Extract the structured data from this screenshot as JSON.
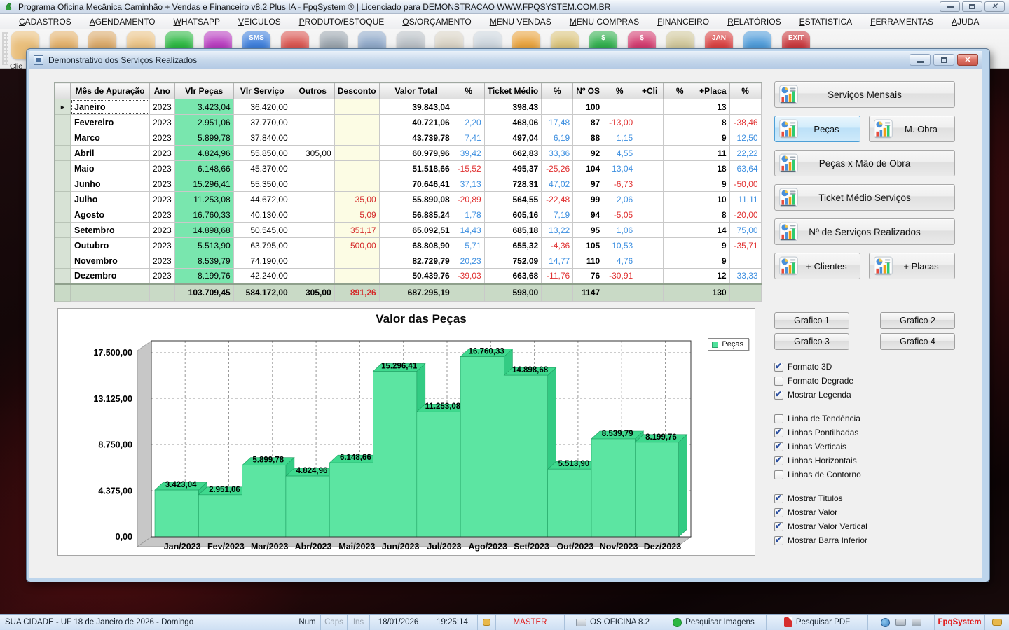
{
  "window": {
    "title": "Programa Oficina Mecânica Caminhão + Vendas e Financeiro v8.2 Plus IA - FpqSystem ® | Licenciado para  DEMONSTRACAO WWW.FPQSYSTEM.COM.BR"
  },
  "menu": {
    "items": [
      "CADASTROS",
      "AGENDAMENTO",
      "WHATSAPP",
      "VEICULOS",
      "PRODUTO/ESTOQUE",
      "OS/ORÇAMENTO",
      "MENU VENDAS",
      "MENU COMPRAS",
      "FINANCEIRO",
      "RELATÓRIOS",
      "ESTATISTICA",
      "FERRAMENTAS",
      "AJUDA"
    ],
    "separator": "|"
  },
  "toolbar": {
    "partial_label": "Clie",
    "items": [
      {
        "name": "clientes",
        "color": "#E9BE7A",
        "glyph": ""
      },
      {
        "name": "fornecedores",
        "color": "#E2B06A",
        "glyph": ""
      },
      {
        "name": "funcionarios",
        "color": "#D9A868",
        "glyph": ""
      },
      {
        "name": "usuarios",
        "color": "#E9C285",
        "glyph": ""
      },
      {
        "name": "whatsapp",
        "color": "#2BB741",
        "glyph": ""
      },
      {
        "name": "instagram",
        "color": "#B73BBF",
        "glyph": ""
      },
      {
        "name": "sms",
        "color": "#3D7EDB",
        "glyph": "SMS"
      },
      {
        "name": "graficos",
        "color": "#D8544F",
        "glyph": ""
      },
      {
        "name": "codigo-barras",
        "color": "#9AA4AD",
        "glyph": ""
      },
      {
        "name": "veiculos",
        "color": "#8FA8C8",
        "glyph": ""
      },
      {
        "name": "impressos",
        "color": "#B8BEC4",
        "glyph": ""
      },
      {
        "name": "ordem-servico",
        "color": "#D8D2C4",
        "glyph": ""
      },
      {
        "name": "documentos",
        "color": "#CBD4DC",
        "glyph": ""
      },
      {
        "name": "arquivos",
        "color": "#E8A23C",
        "glyph": ""
      },
      {
        "name": "caixa",
        "color": "#D9C27A",
        "glyph": ""
      },
      {
        "name": "receitas",
        "color": "#2FAE4C",
        "glyph": "$"
      },
      {
        "name": "despesas",
        "color": "#D23A6E",
        "glyph": "$"
      },
      {
        "name": "notas",
        "color": "#CFC69A",
        "glyph": ""
      },
      {
        "name": "calendario",
        "color": "#D84040",
        "glyph": "JAN"
      },
      {
        "name": "internet",
        "color": "#4D9AD8",
        "glyph": ""
      },
      {
        "name": "sair",
        "color": "#C8373C",
        "glyph": "EXIT"
      }
    ]
  },
  "window2": {
    "title": "Demonstrativo dos Serviços Realizados"
  },
  "table": {
    "columns": [
      "Mês de Apuração",
      "Ano",
      "Vlr Peças",
      "Vlr Serviço",
      "Outros",
      "Desconto",
      "Valor Total",
      "%",
      "Ticket Médio",
      "%",
      "Nº OS",
      "%",
      "+Cli",
      "%",
      "+Placa",
      "%"
    ],
    "rows": [
      [
        "Janeiro",
        "2023",
        "3.423,04",
        "36.420,00",
        "",
        "",
        "39.843,04",
        "",
        "398,43",
        "",
        "100",
        "",
        "",
        "",
        "13",
        ""
      ],
      [
        "Fevereiro",
        "2023",
        "2.951,06",
        "37.770,00",
        "",
        "",
        "40.721,06",
        "2,20",
        "468,06",
        "17,48",
        "87",
        "-13,00",
        "",
        "",
        "8",
        "-38,46"
      ],
      [
        "Marco",
        "2023",
        "5.899,78",
        "37.840,00",
        "",
        "",
        "43.739,78",
        "7,41",
        "497,04",
        "6,19",
        "88",
        "1,15",
        "",
        "",
        "9",
        "12,50"
      ],
      [
        "Abril",
        "2023",
        "4.824,96",
        "55.850,00",
        "305,00",
        "",
        "60.979,96",
        "39,42",
        "662,83",
        "33,36",
        "92",
        "4,55",
        "",
        "",
        "11",
        "22,22"
      ],
      [
        "Maio",
        "2023",
        "6.148,66",
        "45.370,00",
        "",
        "",
        "51.518,66",
        "-15,52",
        "495,37",
        "-25,26",
        "104",
        "13,04",
        "",
        "",
        "18",
        "63,64"
      ],
      [
        "Junho",
        "2023",
        "15.296,41",
        "55.350,00",
        "",
        "",
        "70.646,41",
        "37,13",
        "728,31",
        "47,02",
        "97",
        "-6,73",
        "",
        "",
        "9",
        "-50,00"
      ],
      [
        "Julho",
        "2023",
        "11.253,08",
        "44.672,00",
        "",
        "35,00",
        "55.890,08",
        "-20,89",
        "564,55",
        "-22,48",
        "99",
        "2,06",
        "",
        "",
        "10",
        "11,11"
      ],
      [
        "Agosto",
        "2023",
        "16.760,33",
        "40.130,00",
        "",
        "5,09",
        "56.885,24",
        "1,78",
        "605,16",
        "7,19",
        "94",
        "-5,05",
        "",
        "",
        "8",
        "-20,00"
      ],
      [
        "Setembro",
        "2023",
        "14.898,68",
        "50.545,00",
        "",
        "351,17",
        "65.092,51",
        "14,43",
        "685,18",
        "13,22",
        "95",
        "1,06",
        "",
        "",
        "14",
        "75,00"
      ],
      [
        "Outubro",
        "2023",
        "5.513,90",
        "63.795,00",
        "",
        "500,00",
        "68.808,90",
        "5,71",
        "655,32",
        "-4,36",
        "105",
        "10,53",
        "",
        "",
        "9",
        "-35,71"
      ],
      [
        "Novembro",
        "2023",
        "8.539,79",
        "74.190,00",
        "",
        "",
        "82.729,79",
        "20,23",
        "752,09",
        "14,77",
        "110",
        "4,76",
        "",
        "",
        "9",
        ""
      ],
      [
        "Dezembro",
        "2023",
        "8.199,76",
        "42.240,00",
        "",
        "",
        "50.439,76",
        "-39,03",
        "663,68",
        "-11,76",
        "76",
        "-30,91",
        "",
        "",
        "12",
        "33,33"
      ]
    ],
    "total": [
      "",
      "",
      "103.709,45",
      "584.172,00",
      "305,00",
      "891,26",
      "687.295,19",
      "",
      "598,00",
      "",
      "1147",
      "",
      "",
      "",
      "130",
      ""
    ]
  },
  "panel": {
    "buttons": [
      {
        "id": "servicos-mensais",
        "label": "Serviços Mensais",
        "active": false
      },
      {
        "id": "pecas",
        "label": "Peças",
        "active": true
      },
      {
        "id": "m-obra",
        "label": "M. Obra",
        "active": false
      },
      {
        "id": "pecas-x-mao-de-obra",
        "label": "Peças x Mão de Obra",
        "active": false
      },
      {
        "id": "ticket-medio-servicos",
        "label": "Ticket Médio Serviços",
        "active": false
      },
      {
        "id": "n-de-servicos-realizados",
        "label": "Nº de Serviços Realizados",
        "active": false
      },
      {
        "id": "clientes",
        "label": "+ Clientes",
        "active": false
      },
      {
        "id": "placas",
        "label": "+ Placas",
        "active": false
      }
    ],
    "grafico_buttons": [
      "Grafico 1",
      "Grafico 2",
      "Grafico 3",
      "Grafico 4"
    ],
    "checkbox_groups": [
      [
        {
          "label": "Formato 3D",
          "checked": true
        },
        {
          "label": "Formato Degrade",
          "checked": false
        },
        {
          "label": "Mostrar Legenda",
          "checked": true
        }
      ],
      [
        {
          "label": "Linha de Tendência",
          "checked": false
        },
        {
          "label": "Linhas Pontilhadas",
          "checked": true
        },
        {
          "label": "Linhas Verticais",
          "checked": true
        },
        {
          "label": "Linhas Horizontais",
          "checked": true
        },
        {
          "label": "Linhas de Contorno",
          "checked": false
        }
      ],
      [
        {
          "label": "Mostrar Titulos",
          "checked": true
        },
        {
          "label": "Mostrar Valor",
          "checked": true
        },
        {
          "label": "Mostrar Valor Vertical",
          "checked": true
        },
        {
          "label": "Mostrar Barra Inferior",
          "checked": true
        }
      ]
    ]
  },
  "chart_data": {
    "type": "bar",
    "title": "Valor das Peças",
    "legend": "Peças",
    "legend_position": "top-right",
    "grid": true,
    "style": "3d",
    "categories": [
      "Jan/2023",
      "Fev/2023",
      "Mar/2023",
      "Abr/2023",
      "Mai/2023",
      "Jun/2023",
      "Jul/2023",
      "Ago/2023",
      "Set/2023",
      "Out/2023",
      "Nov/2023",
      "Dez/2023"
    ],
    "values": [
      3423.04,
      2951.06,
      5899.78,
      4824.96,
      6148.66,
      15296.41,
      11253.08,
      16760.33,
      14898.68,
      5513.9,
      8539.79,
      8199.76
    ],
    "value_labels": [
      "3.423,04",
      "2.951,06",
      "5.899,78",
      "4.824,96",
      "6.148,66",
      "15.296,41",
      "11.253,08",
      "16.760,33",
      "14.898,68",
      "5.513,90",
      "8.539,79",
      "8.199,76"
    ],
    "ylim": [
      0,
      17500
    ],
    "yticks": [
      "0,00",
      "4.375,00",
      "8.750,00",
      "13.125,00",
      "17.500,00"
    ],
    "xlabel": "",
    "ylabel": "",
    "colors": {
      "front": "#5CE5A2",
      "top": "#3FD98E",
      "side": "#33CB83",
      "stroke": "#1E9E61"
    }
  },
  "statusbar": {
    "city": "SUA CIDADE - UF 18 de Janeiro de 2026 - Domingo",
    "num": "Num",
    "caps": "Caps",
    "ins": "Ins",
    "date": "18/01/2026",
    "time": "19:25:14",
    "user": "MASTER",
    "module": "OS OFICINA 8.2",
    "search_images": "Pesquisar Imagens",
    "search_pdf": "Pesquisar PDF",
    "brand": "FpqSystem"
  }
}
